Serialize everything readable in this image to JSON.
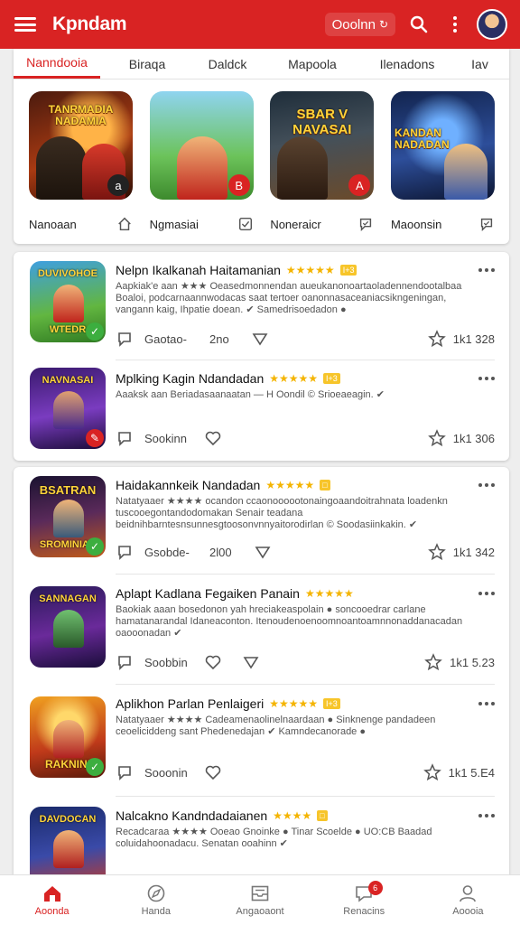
{
  "app_bar": {
    "title": "Kpndam",
    "search_label": "Ooolnn",
    "search_glyph": "↻",
    "icons": [
      "menu-icon",
      "search-icon",
      "more-vert-icon",
      "avatar"
    ],
    "accent_color": "#d92323"
  },
  "tabs": [
    "Nanndooia",
    "Biraqa",
    "Daldck",
    "Mapoola",
    "Ilenadons",
    "Iav"
  ],
  "featured": [
    {
      "art_text": "TANRMADIA NADAMIA",
      "badge": "a",
      "name": "Nanoaan",
      "icon": "home-outline-icon"
    },
    {
      "art_text": "",
      "badge": "B",
      "name": "Ngmasiai",
      "icon": "checkbox-icon"
    },
    {
      "art_text": "SBAR V NAVASAI",
      "badge": "A",
      "name": "Noneraicr",
      "icon": "chat-check-icon"
    },
    {
      "art_text": "KANDAN NADADAN",
      "badge": "",
      "name": "Maoonsin",
      "icon": "chat-check-icon"
    }
  ],
  "apps_group1": [
    {
      "icon_top": "DUVIVOHOE",
      "icon_bottom": "WTEDR",
      "name": "Nelpn Ikalkanah Haitamanian",
      "stars": "★★★★★",
      "tag": "I+3",
      "desc": "Aapkiak'e aan ★★★ Oeasedmonnendan aueukanonoartaoladennendootalbaa Boaloi, podcarnaannwodacas saat tertoer oanonnasaceaniacsikngeningan, vangann kaig, Ihpatie doean. ✔ Samedrisoedadon ●",
      "action_label": "Gaotao-",
      "action_num": "2no",
      "right": "1k1 328"
    },
    {
      "icon_top": "NAVNASAI",
      "icon_bottom": "",
      "name": "Mplking Kagin Ndandadan",
      "stars": "★★★★★",
      "tag": "I+3",
      "desc": "Aaaksk aan Beriadasaanaatan — H Oondil © Srioeaeagin. ✔",
      "action_label": "Sookinn",
      "action_num": "",
      "right": "1k1 306"
    }
  ],
  "apps_group2": [
    {
      "icon_top": "BSATRAN",
      "icon_bottom": "SROMINIAS",
      "name": "Haidakannkeik Nandadan",
      "stars": "★★★★★",
      "tag": "□",
      "desc": "Natatyaaer ★★★★ ocandon ccaonoooootonaingoaandoitrahnata loadenkn tuscooegontandodomakan Senair teadana beidnihbarntesnsunnesgtoosonvnnyaitorodirlan © Soodasiinkakin. ✔",
      "action_label": "Gsobde-",
      "action_num": "2l00",
      "right": "1k1 342"
    },
    {
      "icon_top": "SANNAGAN",
      "icon_bottom": "",
      "name": "Aplapt Kadlana Fegaiken Panain",
      "stars": "★★★★★",
      "tag": "",
      "desc": "Baokiak aaan bosedonon yah hreciakeaspolain ● soncooedrar carlane hamatanarandal Idaneaconton. Itenoudenoenoomnoantoamnnonaddanacadan oaooonadan ✔",
      "action_label": "Soobbin",
      "action_num": "",
      "right": "1k1 5.23"
    },
    {
      "icon_top": "",
      "icon_bottom": "RAKNINI",
      "name": "Aplikhon Parlan Penlaigeri",
      "stars": "★★★★★",
      "tag": "I+3",
      "desc": "Natatyaaer ★★★★ Cadeamenaolinelnaardaan ● Sinknenge pandadeen ceoeliciddeng sant Phedenedajan ✔ Kamndecanorade ●",
      "action_label": "Sooonin",
      "action_num": "",
      "right": "1k1 5.E4"
    },
    {
      "icon_top": "DAVDOCAN",
      "icon_bottom": "",
      "name": "Nalcakno Kandndadaianen",
      "stars": "★★★★",
      "tag": "□",
      "desc": "Recadcaraa ★★★★ Ooeao Gnoinke ● Tinar Scoelde ● UO:CB Baadad coluidahoonadacu. Senatan ooahinn ✔",
      "action_label": "",
      "action_num": "",
      "right": ""
    }
  ],
  "bottom_nav": [
    {
      "label": "Aoonda",
      "icon": "home-icon"
    },
    {
      "label": "Handa",
      "icon": "explore-icon"
    },
    {
      "label": "Angaoaont",
      "icon": "inbox-icon"
    },
    {
      "label": "Renacins",
      "icon": "notifications-icon",
      "badge": "6"
    },
    {
      "label": "Aoooia",
      "icon": "profile-icon"
    }
  ]
}
